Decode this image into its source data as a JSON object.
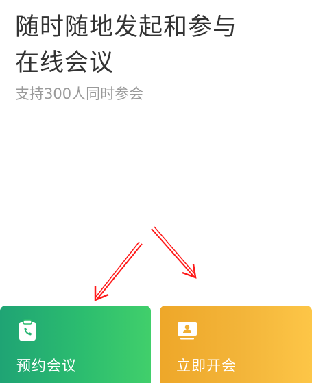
{
  "header": {
    "headline_line1": "随时随地发起和参与",
    "headline_line2": "在线会议",
    "subtitle": "支持300人同时参会"
  },
  "actions": {
    "schedule": {
      "label": "预约会议",
      "icon": "clipboard-phone-icon",
      "gradient_start": "#1fa474",
      "gradient_end": "#41cf6b"
    },
    "start_now": {
      "label": "立即开会",
      "icon": "monitor-person-icon",
      "gradient_start": "#eea729",
      "gradient_end": "#fdc647"
    }
  },
  "annotation": {
    "arrow_color": "#ff1a1a"
  }
}
